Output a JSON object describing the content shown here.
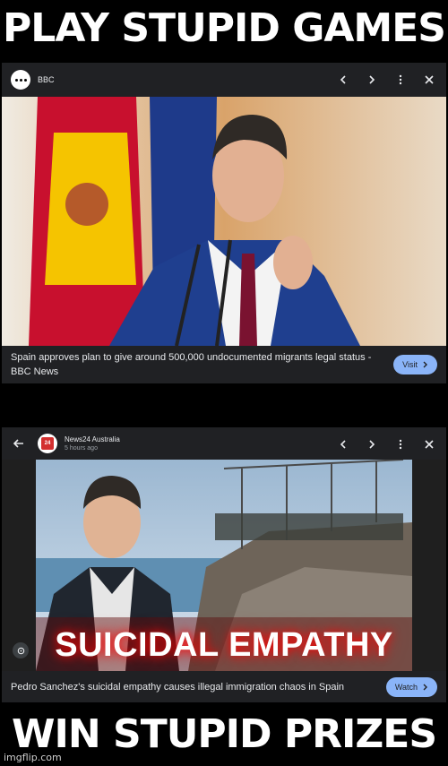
{
  "meme": {
    "top_caption": "PLAY STUPID GAMES",
    "bottom_caption": "WIN STUPID PRIZES",
    "watermark": "imgflip.com"
  },
  "card1": {
    "source_name": "BBC",
    "headline": "Spain approves plan to give around 500,000 undocumented migrants legal status - BBC News",
    "action_label": "Visit"
  },
  "card2": {
    "source_name": "News24 Australia",
    "source_logo_text": "24",
    "time_ago": "5 hours ago",
    "thumbnail_text": "SUICIDAL EMPATHY",
    "headline": "Pedro Sanchez's suicidal empathy causes illegal immigration chaos in Spain",
    "action_label": "Watch"
  },
  "colors": {
    "background": "#000000",
    "card_bg": "#202124",
    "accent_button": "#8ab4f8",
    "text_primary": "#e8eaed",
    "text_secondary": "#9aa0a6"
  },
  "icons": {
    "card1": [
      "bbc-logo-icon",
      "chevron-left-icon",
      "chevron-right-icon",
      "more-vert-icon",
      "close-icon",
      "lens-icon"
    ],
    "card2": [
      "back-arrow-icon",
      "news24-logo-icon",
      "chevron-left-icon",
      "chevron-right-icon",
      "more-vert-icon",
      "close-icon",
      "lens-icon"
    ]
  }
}
